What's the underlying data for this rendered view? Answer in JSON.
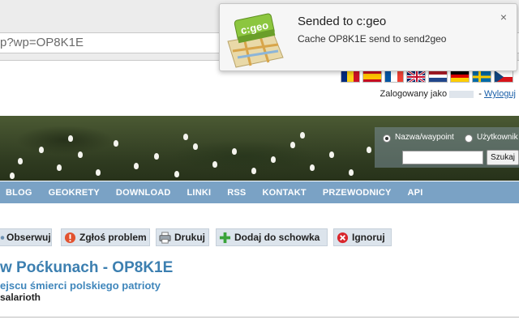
{
  "browser": {
    "url_visible": "p?wp=OP8K1E"
  },
  "notification": {
    "title": "Sended to c:geo",
    "body": "Cache OP8K1E send to send2geo",
    "icon": "cgeo-map-icon",
    "close": "×"
  },
  "flags": [
    "ro",
    "es",
    "fr",
    "gb",
    "nl",
    "de",
    "se",
    "cz"
  ],
  "login": {
    "prefix": "Zalogowany jako",
    "logout": "Wyloguj"
  },
  "search": {
    "option1": "Nazwa/waypoint",
    "option2": "Użytkownik",
    "button": "Szukaj",
    "value": ""
  },
  "nav": {
    "items": [
      "BLOG",
      "GEOKRETY",
      "DOWNLOAD",
      "LINKI",
      "RSS",
      "KONTAKT",
      "PRZEWODNICY",
      "API"
    ]
  },
  "actions": {
    "watch": "Obserwuj",
    "report": "Zgłoś problem",
    "print": "Drukuj",
    "add": "Dodaj do schowka",
    "ignore": "Ignoruj"
  },
  "cache": {
    "title": "w Poćkunach - OP8K1E",
    "subtitle": "ejscu śmierci polskiego patrioty",
    "author": "salarioth"
  },
  "colors": {
    "nav_bg": "#7aa2c5",
    "title": "#3c7fb0",
    "action_bg": "#dce4ec"
  }
}
